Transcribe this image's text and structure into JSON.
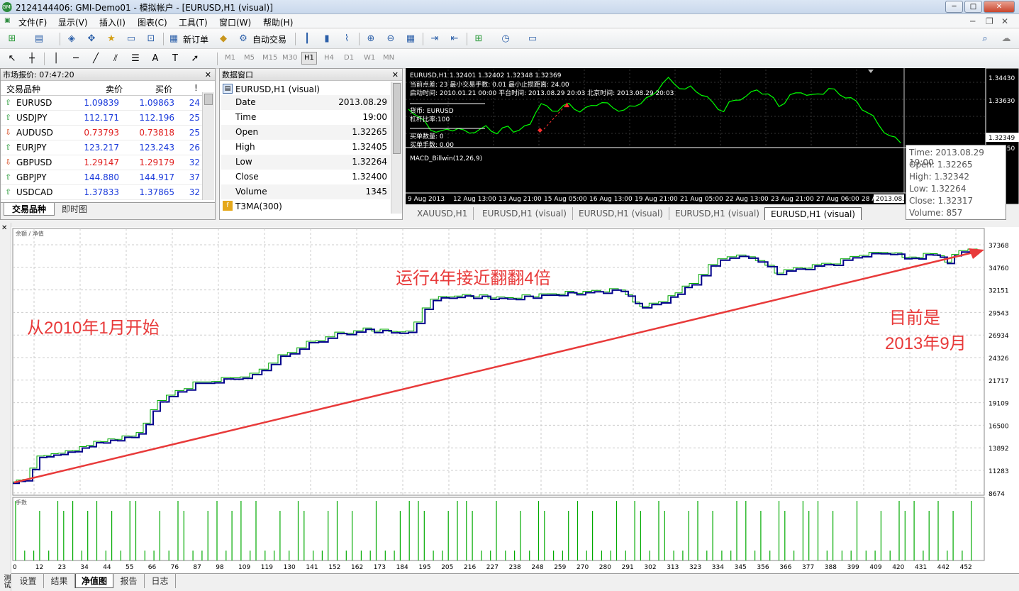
{
  "window": {
    "title": "2124144406: GMI-Demo01 - 模拟帐户 - [EURUSD,H1 (visual)]",
    "min": "─",
    "max": "□",
    "close": "✕"
  },
  "menu": [
    "文件(F)",
    "显示(V)",
    "插入(I)",
    "图表(C)",
    "工具(T)",
    "窗口(W)",
    "帮助(H)"
  ],
  "toolbar": {
    "new_order": "新订单",
    "auto_trade": "自动交易"
  },
  "timeframes": [
    "M1",
    "M5",
    "M15",
    "M30",
    "H1",
    "H4",
    "D1",
    "W1",
    "MN"
  ],
  "market_watch": {
    "title": "市场报价: 07:47:20",
    "col_symbol": "交易品种",
    "col_bid": "卖价",
    "col_ask": "买价",
    "col_spread": "!",
    "rows": [
      {
        "symbol": "EURUSD",
        "bid": "1.09839",
        "ask": "1.09863",
        "spread": "24",
        "dir": "up"
      },
      {
        "symbol": "USDJPY",
        "bid": "112.171",
        "ask": "112.196",
        "spread": "25",
        "dir": "up"
      },
      {
        "symbol": "AUDUSD",
        "bid": "0.73793",
        "ask": "0.73818",
        "spread": "25",
        "dir": "down"
      },
      {
        "symbol": "EURJPY",
        "bid": "123.217",
        "ask": "123.243",
        "spread": "26",
        "dir": "up"
      },
      {
        "symbol": "GBPUSD",
        "bid": "1.29147",
        "ask": "1.29179",
        "spread": "32",
        "dir": "down"
      },
      {
        "symbol": "GBPJPY",
        "bid": "144.880",
        "ask": "144.917",
        "spread": "37",
        "dir": "up"
      },
      {
        "symbol": "USDCAD",
        "bid": "1.37833",
        "ask": "1.37865",
        "spread": "32",
        "dir": "up"
      }
    ],
    "tabs": [
      "交易品种",
      "即时图"
    ]
  },
  "data_window": {
    "title": "数据窗口",
    "chart_name": "EURUSD,H1 (visual)",
    "rows": [
      {
        "k": "Date",
        "v": "2013.08.29"
      },
      {
        "k": "Time",
        "v": "19:00"
      },
      {
        "k": "Open",
        "v": "1.32265"
      },
      {
        "k": "High",
        "v": "1.32405"
      },
      {
        "k": "Low",
        "v": "1.32264"
      },
      {
        "k": "Close",
        "v": "1.32400"
      },
      {
        "k": "Volume",
        "v": "1345"
      }
    ],
    "indicator": "T3MA(300)"
  },
  "price_chart": {
    "header": "EURUSD,H1  1.32401 1.32402 1.32348 1.32369",
    "info1": "当前点差: 23  最小交易手数:  0.01  最小止损距离: 24.00",
    "info2": "启动时间:  2010.01.21 00:00   平台时间:  2013.08.29 20:03   北京时间:  2013.08.29 20:03",
    "info3": "货币:  EURUSD",
    "info4": "杠杆比率:100",
    "info5": "买单数量:  0",
    "info6": "买单手数:  0.00",
    "price_labels": [
      "1.34430",
      "1.33630",
      "1.32349",
      "1.32050"
    ],
    "macd_label": "MACD_Billwin(12,26,9)",
    "x_labels": [
      "9 Aug 2013",
      "12 Aug 13:00",
      "13 Aug 21:00",
      "15 Aug 05:00",
      "16 Aug 13:00",
      "19 Aug 21:00",
      "21 Aug 05:00",
      "22 Aug 13:00",
      "23 Aug 21:00",
      "27 Aug 06:00",
      "28 A",
      "2013.08."
    ],
    "line_color": "#00ff00"
  },
  "chart_tabs": [
    "XAUUSD,H1",
    "EURUSD,H1 (visual)",
    "EURUSD,H1 (visual)",
    "EURUSD,H1 (visual)",
    "EURUSD,H1 (visual)"
  ],
  "tooltip": [
    "Time: 2013.08.29 19:00",
    "Open: 1.32265",
    "High: 1.32342",
    "Low:  1.32264",
    "Close: 1.32317",
    "Volume: 857"
  ],
  "equity_chart": {
    "legend": "余额 / 净值",
    "lots_label": "手数",
    "y_labels": [
      "37368",
      "34760",
      "32151",
      "29543",
      "26934",
      "24326",
      "21717",
      "19109",
      "16500",
      "13892",
      "11283",
      "8674"
    ],
    "x_labels": [
      "0",
      "12",
      "23",
      "34",
      "44",
      "55",
      "66",
      "76",
      "87",
      "98",
      "109",
      "119",
      "130",
      "141",
      "152",
      "162",
      "173",
      "184",
      "195",
      "205",
      "216",
      "227",
      "238",
      "248",
      "259",
      "270",
      "280",
      "291",
      "302",
      "313",
      "323",
      "334",
      "345",
      "356",
      "366",
      "377",
      "388",
      "399",
      "409",
      "420",
      "431",
      "442",
      "452"
    ],
    "annotation_start": "从2010年1月开始",
    "annotation_mid": "运行4年接近翻翻4倍",
    "annotation_now_1": "目前是",
    "annotation_now_2": "2013年9月",
    "balance_color": "#00008b",
    "equity_color": "#00aa00",
    "arrow_color": "#e83a3a"
  },
  "bottom_tabs": [
    "设置",
    "结果",
    "净值图",
    "报告",
    "日志"
  ],
  "side_label": "测试"
}
